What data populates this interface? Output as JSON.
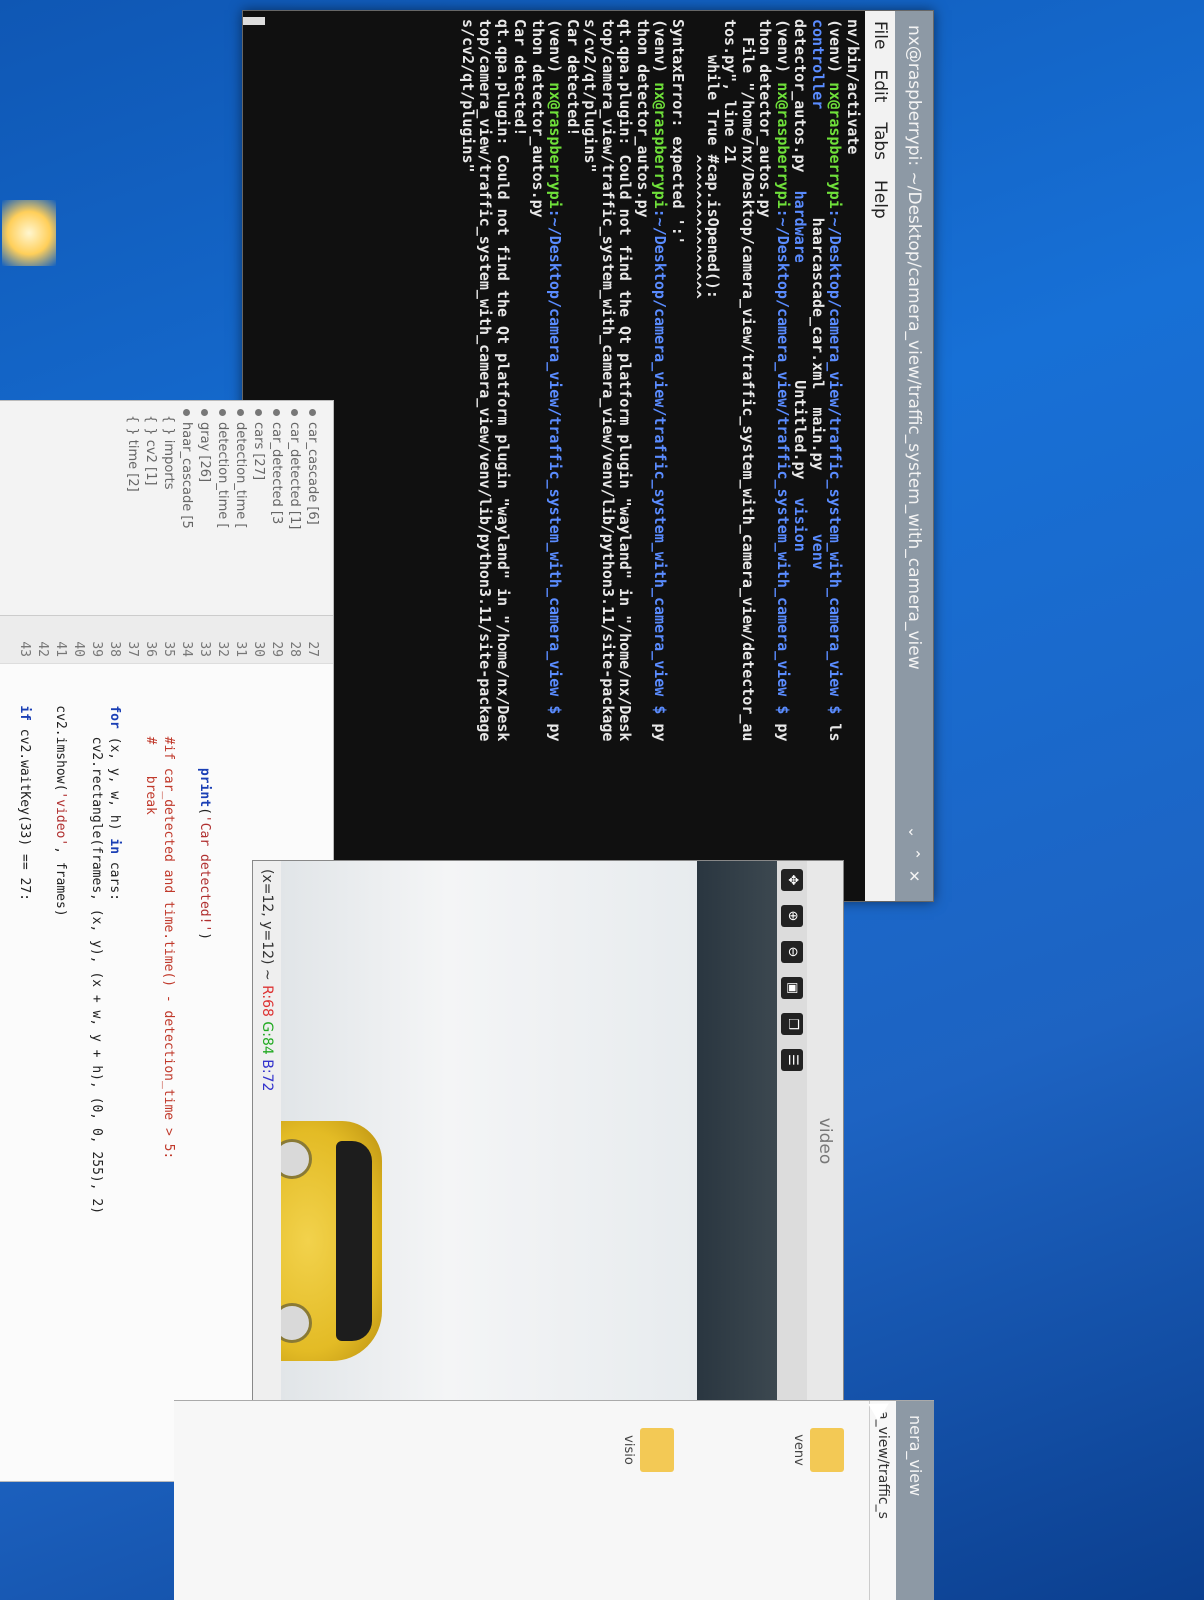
{
  "terminal": {
    "title": "nx@raspberrypi: ~/Desktop/camera_view/traffic_system_with_camera_view",
    "menu": [
      "File",
      "Edit",
      "Tabs",
      "Help"
    ],
    "lines": [
      [
        {
          "t": "nv/bin/activate",
          "c": ""
        }
      ],
      [
        {
          "t": "(venv) ",
          "c": ""
        },
        {
          "t": "nx@raspberrypi",
          "c": "g"
        },
        {
          "t": ":~/Desktop/camera_view/traffic_system_with_camera_view $ ",
          "c": "b"
        },
        {
          "t": "ls",
          "c": ""
        }
      ],
      [
        {
          "t": "controller",
          "c": "b"
        },
        {
          "t": "            haarcascade_car.xml  main.py       ",
          "c": ""
        },
        {
          "t": "venv",
          "c": "b"
        }
      ],
      [
        {
          "t": "detector_autos.py  ",
          "c": ""
        },
        {
          "t": "hardware",
          "c": "b"
        },
        {
          "t": "             Untitled.py  ",
          "c": ""
        },
        {
          "t": "vision",
          "c": "b"
        }
      ],
      [
        {
          "t": "(venv) ",
          "c": ""
        },
        {
          "t": "nx@raspberrypi",
          "c": "g"
        },
        {
          "t": ":~/Desktop/camera_view/traffic_system_with_camera_view $ ",
          "c": "b"
        },
        {
          "t": "py",
          "c": ""
        }
      ],
      [
        {
          "t": "thon detector_autos.py",
          "c": ""
        }
      ],
      [
        {
          "t": "  File \"/home/nx/Desktop/camera_view/traffic_system_with_camera_view/detector_au",
          "c": ""
        }
      ],
      [
        {
          "t": "tos.py\", line 21",
          "c": ""
        }
      ],
      [
        {
          "t": "    while True #cap.isOpened():",
          "c": ""
        }
      ],
      [
        {
          "t": "               ^^^^^^^^^^^^^^^^",
          "c": ""
        }
      ],
      [
        {
          "t": "SyntaxError: expected ':'",
          "c": ""
        }
      ],
      [
        {
          "t": "(venv) ",
          "c": ""
        },
        {
          "t": "nx@raspberrypi",
          "c": "g"
        },
        {
          "t": ":~/Desktop/camera_view/traffic_system_with_camera_view $ ",
          "c": "b"
        },
        {
          "t": "py",
          "c": ""
        }
      ],
      [
        {
          "t": "thon detector_autos.py",
          "c": ""
        }
      ],
      [
        {
          "t": "qt.qpa.plugin: Could not find the Qt platform plugin \"wayland\" in \"/home/nx/Desk",
          "c": ""
        }
      ],
      [
        {
          "t": "top/camera_view/traffic_system_with_camera_view/venv/lib/python3.11/site-package",
          "c": ""
        }
      ],
      [
        {
          "t": "s/cv2/qt/plugins\"",
          "c": ""
        }
      ],
      [
        {
          "t": "Car detected!",
          "c": ""
        }
      ],
      [
        {
          "t": "(venv) ",
          "c": ""
        },
        {
          "t": "nx@raspberrypi",
          "c": "g"
        },
        {
          "t": ":~/Desktop/camera_view/traffic_system_with_camera_view $ ",
          "c": "b"
        },
        {
          "t": "py",
          "c": ""
        }
      ],
      [
        {
          "t": "thon detector_autos.py",
          "c": ""
        }
      ],
      [
        {
          "t": "Car detected!",
          "c": ""
        }
      ],
      [
        {
          "t": "qt.qpa.plugin: Could not find the Qt platform plugin \"wayland\" in \"/home/nx/Desk",
          "c": ""
        }
      ],
      [
        {
          "t": "top/camera_view/traffic_system_with_camera_view/venv/lib/python3.11/site-package",
          "c": ""
        }
      ],
      [
        {
          "t": "s/cv2/qt/plugins\"",
          "c": ""
        }
      ]
    ]
  },
  "video": {
    "title": "video",
    "toolbar_icons": [
      "pan-icon",
      "zoom-in-icon",
      "zoom-out-icon",
      "save-image-icon",
      "copy-image-icon",
      "properties-icon"
    ],
    "status": {
      "coords": "(x=12, y=12) ~",
      "r": "R:68",
      "g": "G:84",
      "b": "B:72"
    }
  },
  "editor": {
    "outline": [
      {
        "kind": "dot",
        "label": "car_cascade [6]"
      },
      {
        "kind": "dot",
        "label": "car_detected [1]"
      },
      {
        "kind": "dot",
        "label": "car_detected [3"
      },
      {
        "kind": "dot",
        "label": "cars [27]"
      },
      {
        "kind": "dot",
        "label": "detection_time ["
      },
      {
        "kind": "dot",
        "label": "detection_time ["
      },
      {
        "kind": "dot",
        "label": "gray [26]"
      },
      {
        "kind": "dot",
        "label": "haar_cascade [5"
      },
      {
        "kind": "brace",
        "label": "{ } imports"
      },
      {
        "kind": "brace",
        "label": "{ } cv2 [1]"
      },
      {
        "kind": "brace",
        "label": "{ } time [2]"
      }
    ],
    "line_numbers": [
      "27",
      "28",
      "29",
      "30",
      "31",
      "32",
      "33",
      "34",
      "35",
      "36",
      "37",
      "38",
      "39",
      "40",
      "41",
      "42",
      "43"
    ],
    "code": [
      "",
      "",
      "",
      "",
      "",
      "",
      "            print('Car detected!')",
      "",
      "        #if car_detected and time.time() - detection_time > 5:",
      "        #    break",
      "",
      "    for (x, y, w, h) in cars:",
      "        cv2.rectangle(frames, (x, y), (x + w, y + h), (0, 0, 255), 2)",
      "",
      "    cv2.imshow('video', frames)",
      "",
      "    if cv2.waitKey(33) == 27:"
    ]
  },
  "filemgr": {
    "title": "nera_view",
    "path": "a_view/traffic_s",
    "items": [
      "venv",
      "visio"
    ]
  }
}
